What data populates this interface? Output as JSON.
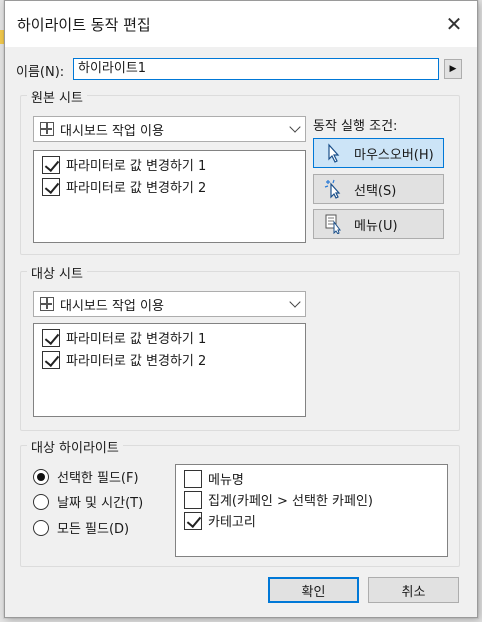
{
  "dialog": {
    "title": "하이라이트 동작 편집",
    "close_glyph": "✕"
  },
  "name_field": {
    "label": "이름(N):",
    "value": "하이라이트1",
    "insert_glyph": "▶"
  },
  "source_sheets": {
    "group_label": "원본 시트",
    "dropdown_value": "대시보드 작업 이용",
    "items": [
      {
        "label": "파라미터로 값 변경하기 1",
        "checked": true
      },
      {
        "label": "파라미터로 값 변경하기 2",
        "checked": true
      }
    ]
  },
  "run_action_on": {
    "label": "동작 실행 조건:",
    "options": [
      {
        "label": "마우스오버(H)",
        "selected": true,
        "icon": "pointer-hover-icon"
      },
      {
        "label": "선택(S)",
        "selected": false,
        "icon": "select-sparkle-icon"
      },
      {
        "label": "메뉴(U)",
        "selected": false,
        "icon": "menu-pointer-icon"
      }
    ]
  },
  "target_sheets": {
    "group_label": "대상 시트",
    "dropdown_value": "대시보드 작업 이용",
    "items": [
      {
        "label": "파라미터로 값 변경하기 1",
        "checked": true
      },
      {
        "label": "파라미터로 값 변경하기 2",
        "checked": true
      }
    ]
  },
  "target_highlighting": {
    "group_label": "대상 하이라이트",
    "radios": [
      {
        "label": "선택한 필드(F)",
        "checked": true
      },
      {
        "label": "날짜 및 시간(T)",
        "checked": false
      },
      {
        "label": "모든 필드(D)",
        "checked": false
      }
    ],
    "fields": [
      {
        "label": "메뉴명",
        "checked": false
      },
      {
        "label": "집계(카페인 > 선택한 카페인)",
        "checked": false
      },
      {
        "label": "카테고리",
        "checked": true
      }
    ]
  },
  "footer": {
    "ok_label": "확인",
    "cancel_label": "취소"
  },
  "colors": {
    "accent": "#0078d7",
    "selected_bg": "#cce4f7",
    "dialog_bg": "#f0f0f0"
  }
}
